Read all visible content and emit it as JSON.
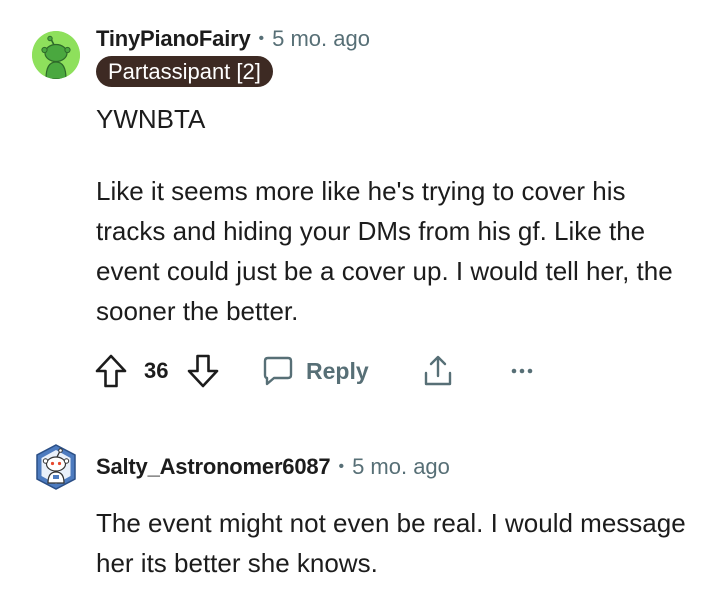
{
  "comments": [
    {
      "username": "TinyPianoFairy",
      "separator": "•",
      "time": "5 mo. ago",
      "flair": "Partassipant [2]",
      "paragraphs": [
        "YWNBTA",
        "Like it seems more like he's trying to cover his tracks and hiding your DMs from his gf. Like the event could just be a cover up. I would tell her, the sooner the better."
      ],
      "vote_count": "36",
      "reply_label": "Reply",
      "avatar_color": "#8ee05c"
    },
    {
      "username": "Salty_Astronomer6087",
      "separator": "•",
      "time": "5 mo. ago",
      "paragraphs": [
        "The event might not even be real. I would message her its better she knows."
      ]
    }
  ],
  "colors": {
    "text": "#1c1c1c",
    "meta": "#576f76",
    "flair_bg": "#3d2a23",
    "flair_text": "#ffffff"
  },
  "icons": {
    "upvote": "arrow-up-icon",
    "downvote": "arrow-down-icon",
    "reply": "speech-bubble-icon",
    "share": "share-icon",
    "more": "ellipsis-icon"
  }
}
